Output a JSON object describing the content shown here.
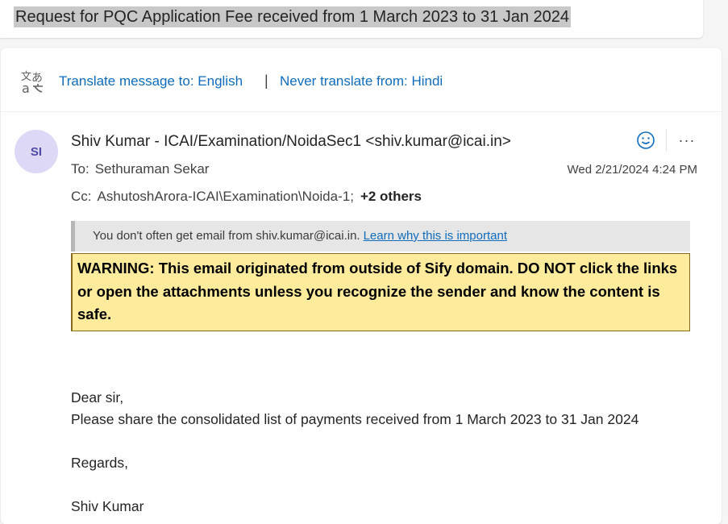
{
  "subject": "Request for PQC Application Fee received from 1 March 2023 to 31 Jan 2024",
  "translate": {
    "icon": "translate-icon",
    "translate_link": "Translate message to: English",
    "separator": "|",
    "never_link": "Never translate from: Hindi"
  },
  "message": {
    "avatar_initials": "SI",
    "sender": "Shiv Kumar - ICAI/Examination/NoidaSec1 <shiv.kumar@icai.in>",
    "to_label": "To:",
    "to_value": "Sethuraman Sekar",
    "cc_label": "Cc:",
    "cc_value": "AshutoshArora-ICAI\\Examination\\Noida-1;",
    "cc_others": "+2 others",
    "date": "Wed 2/21/2024 4:24 PM",
    "more_label": "···"
  },
  "notice": {
    "text": "You don't often get email from shiv.kumar@icai.in.",
    "link": "Learn why this is important"
  },
  "warning": {
    "text": "WARNING: This email originated from outside of Sify domain. DO NOT click the links or open the attachments unless you recognize the sender and know the content is safe."
  },
  "body": {
    "greeting": "Dear sir,",
    "line1": "Please share the consolidated list of payments received from 1 March 2023 to 31 Jan 2024",
    "regards": "Regards,",
    "signature": "Shiv Kumar"
  },
  "colors": {
    "link": "#0f6cbd",
    "warning_bg": "#ffeb9c",
    "avatar_bg": "#dcd8f5",
    "avatar_fg": "#4f4aa8"
  }
}
